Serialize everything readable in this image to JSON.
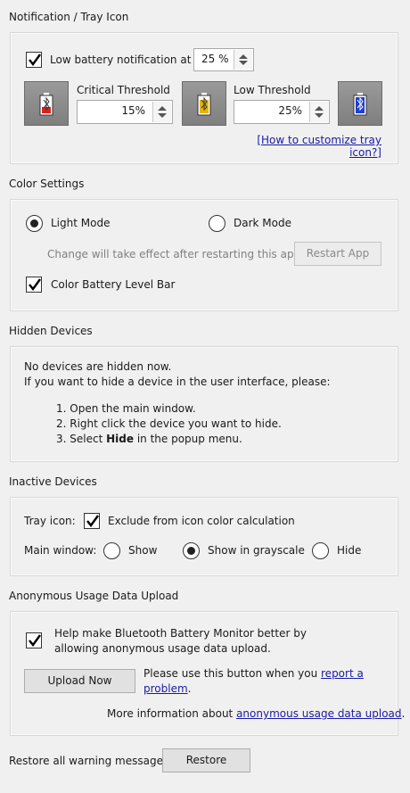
{
  "notification": {
    "section_title": "Notification / Tray Icon",
    "low_battery_label": "Low battery notification at",
    "low_battery_value": "25 %",
    "critical_label": "Critical Threshold",
    "critical_value": "15%",
    "low_label": "Low Threshold",
    "low_value": "25%",
    "customize_link": "[How to customize tray icon?]",
    "colors": {
      "critical": "#e02020",
      "low": "#e8b400",
      "normal": "#1f3fd0"
    }
  },
  "color_settings": {
    "section_title": "Color Settings",
    "light_mode": "Light Mode",
    "dark_mode": "Dark Mode",
    "restart_note": "Change will take effect after restarting this app.",
    "restart_button": "Restart App",
    "color_bar_label": "Color Battery Level Bar"
  },
  "hidden_devices": {
    "section_title": "Hidden Devices",
    "line1": "No devices are hidden now.",
    "line2": "If you want to hide a device in the user interface, please:",
    "step1": "1. Open the main window.",
    "step2": "2. Right click the device you want to hide.",
    "step3_prefix": "3. Select ",
    "step3_bold": "Hide",
    "step3_suffix": " in the popup menu."
  },
  "inactive_devices": {
    "section_title": "Inactive Devices",
    "tray_icon_label": "Tray icon:",
    "exclude_label": "Exclude from  icon color calculation",
    "main_window_label": "Main window:",
    "opt_show": "Show",
    "opt_grayscale": "Show in grayscale",
    "opt_hide": "Hide"
  },
  "usage": {
    "section_title": "Anonymous Usage Data Upload",
    "help_line1": "Help make Bluetooth Battery Monitor better by",
    "help_line2": "allowing anonymous usage data upload.",
    "upload_button": "Upload Now",
    "upload_note_prefix": "Please use this button when you ",
    "upload_note_link1": "report a",
    "upload_note_link2": "problem",
    "upload_note_suffix": ".",
    "more_info_prefix": "More information about ",
    "more_info_link": "anonymous usage data upload",
    "more_info_suffix": "."
  },
  "restore": {
    "label": "Restore all warning messages",
    "button": "Restore"
  }
}
